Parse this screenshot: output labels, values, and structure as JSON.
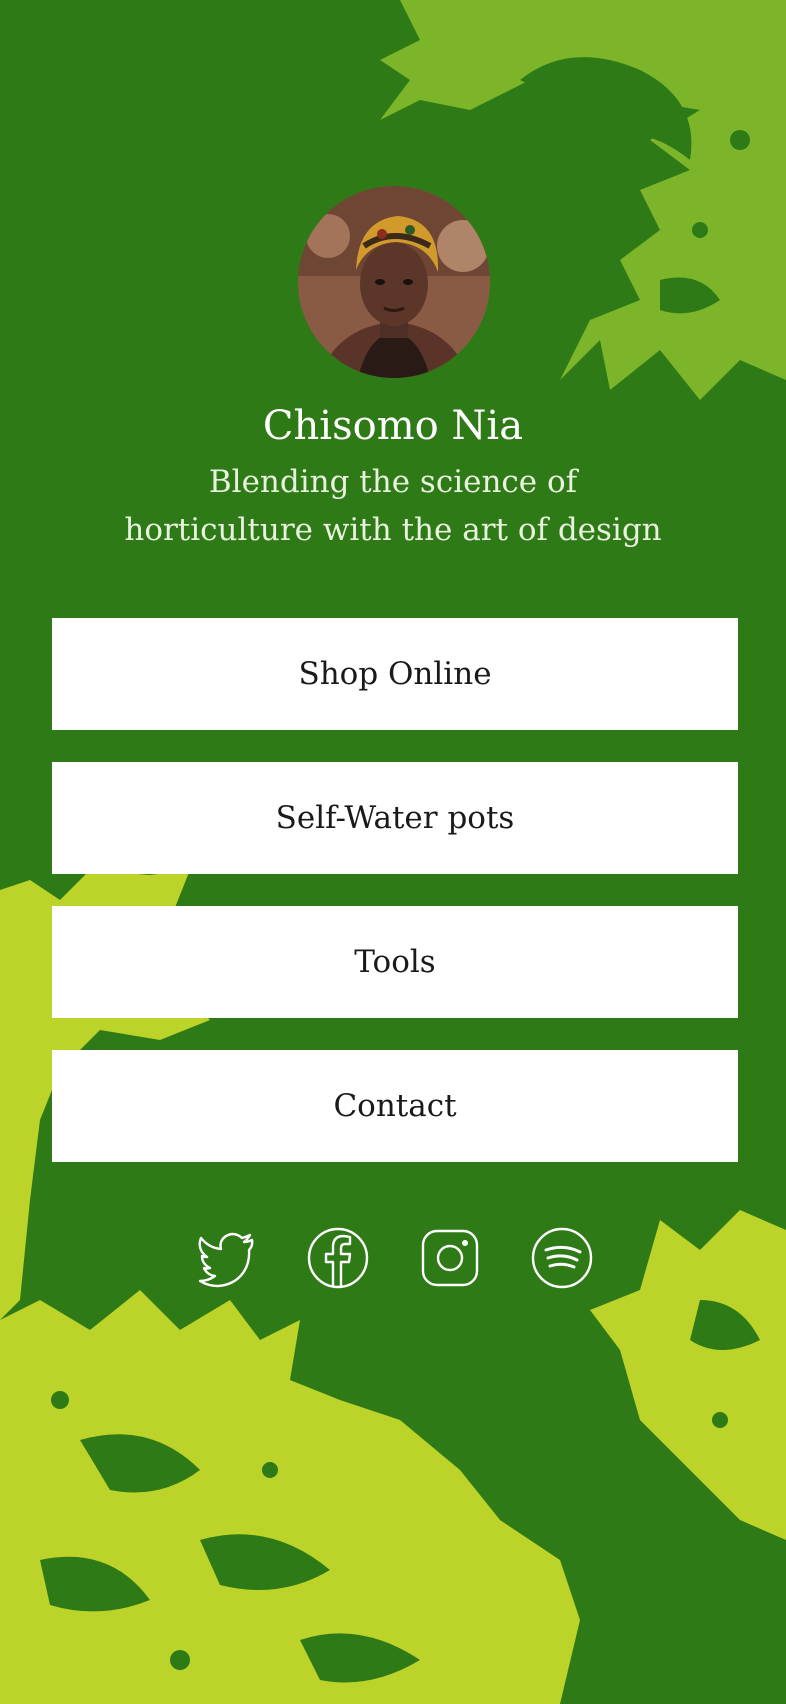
{
  "profile": {
    "name": "Chisomo Nia",
    "bio": "Blending the science of horticulture with the art of design"
  },
  "links": [
    {
      "label": "Shop Online"
    },
    {
      "label": "Self-Water pots"
    },
    {
      "label": "Tools"
    },
    {
      "label": "Contact"
    }
  ],
  "socials": [
    {
      "icon": "twitter-icon"
    },
    {
      "icon": "facebook-icon"
    },
    {
      "icon": "instagram-icon"
    },
    {
      "icon": "spotify-icon"
    }
  ],
  "colors": {
    "background": "#2d7a16",
    "leaf_upper": "#7db52a",
    "leaf_lower": "#bcd32a",
    "button": "#ffffff",
    "button_text": "#1a1a1a",
    "text": "#ffffff"
  }
}
